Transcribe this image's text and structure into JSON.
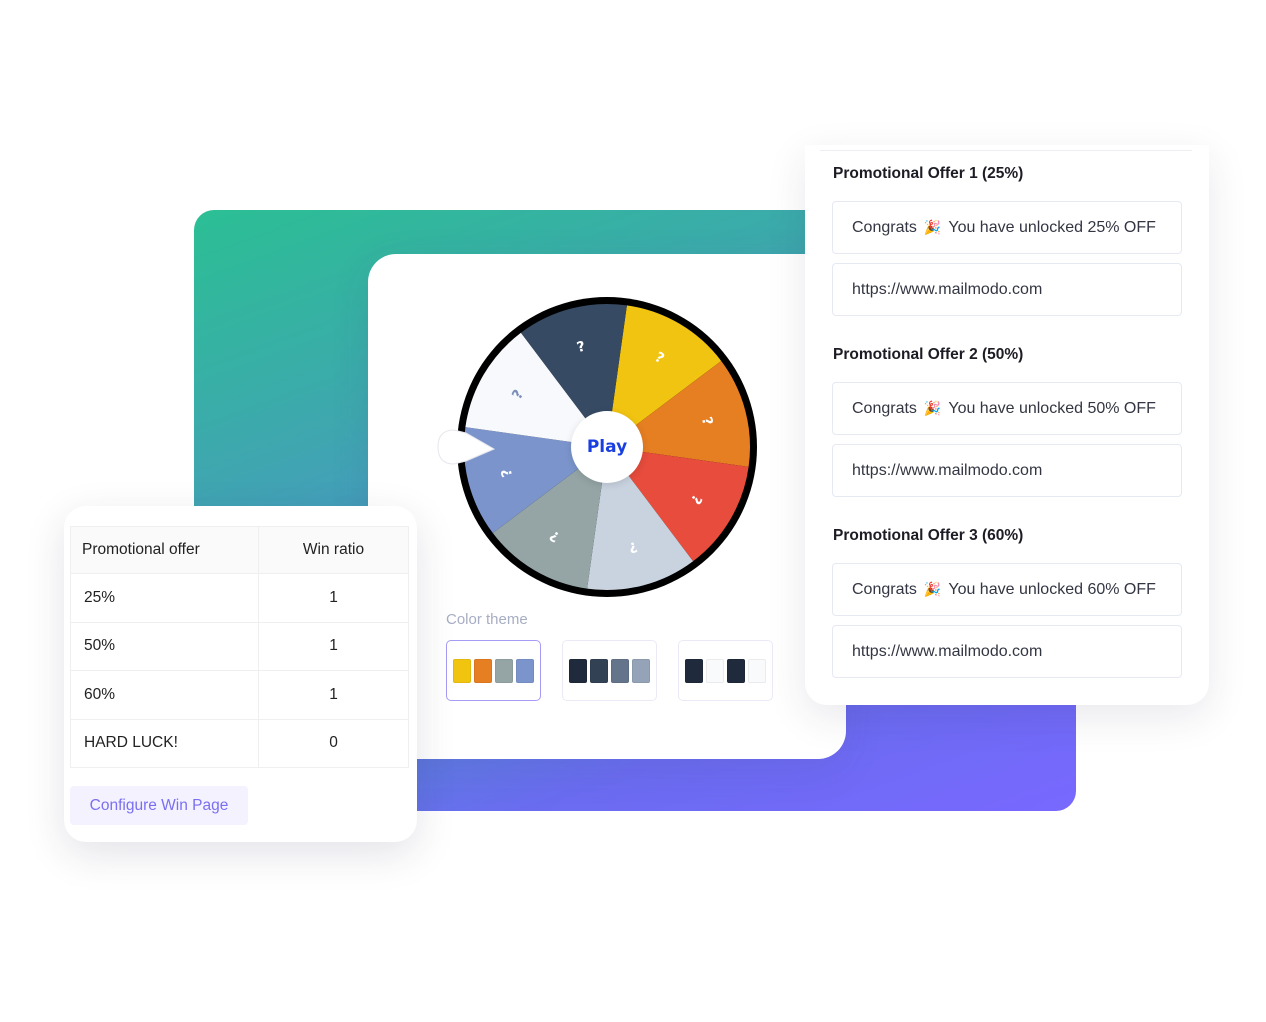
{
  "wheel": {
    "play_label": "Play",
    "segment_glyph": "?",
    "segment_colors": [
      "#f1c411",
      "#e67e22",
      "#e74c3c",
      "#c9d3e0",
      "#95a5a6",
      "#7b95cc",
      "#f7f9fc",
      "#364a63"
    ],
    "glyph_colors": [
      "#ffffff",
      "#ffffff",
      "#ffffff",
      "#ffffff",
      "#ffffff",
      "#ffffff",
      "#7b8fb8",
      "#ffffff"
    ],
    "rim_color": "#000000"
  },
  "color_theme": {
    "label": "Color theme",
    "selected_index": 0,
    "themes": [
      {
        "name": "theme-bright",
        "swatches": [
          "#f1c40f",
          "#e67e22",
          "#95a5a6",
          "#7b95cc"
        ]
      },
      {
        "name": "theme-slate",
        "swatches": [
          "#1f2a3c",
          "#334155",
          "#64748b",
          "#94a3b8"
        ]
      },
      {
        "name": "theme-contrast",
        "swatches": [
          "#1f2a3c",
          "#f8fafc",
          "#1f2a3c",
          "#f8fafc"
        ]
      }
    ]
  },
  "win_table": {
    "headers": [
      "Promotional offer",
      "Win ratio"
    ],
    "rows": [
      {
        "offer": "25%",
        "ratio": "1"
      },
      {
        "offer": "50%",
        "ratio": "1"
      },
      {
        "offer": "60%",
        "ratio": "1"
      },
      {
        "offer": "HARD LUCK!",
        "ratio": "0"
      }
    ],
    "configure_label": "Configure Win Page"
  },
  "offers": [
    {
      "title": "Promotional Offer 1 (25%)",
      "message_prefix": "Congrats",
      "message_icon": "party-popper-icon",
      "message_suffix": "You have unlocked 25% OFF",
      "url": "https://www.mailmodo.com"
    },
    {
      "title": "Promotional Offer 2 (50%)",
      "message_prefix": "Congrats",
      "message_icon": "party-popper-icon",
      "message_suffix": "You have unlocked 50% OFF",
      "url": "https://www.mailmodo.com"
    },
    {
      "title": "Promotional Offer 3 (60%)",
      "message_prefix": "Congrats",
      "message_icon": "party-popper-icon",
      "message_suffix": "You have unlocked 60% OFF",
      "url": "https://www.mailmodo.com"
    }
  ],
  "icons": {
    "party_popper": "🎉"
  },
  "colors": {
    "accent_purple": "#7868ff",
    "accent_green": "#2bbf94",
    "play_text": "#1a3fe0",
    "configure_text": "#7a6ff0"
  }
}
